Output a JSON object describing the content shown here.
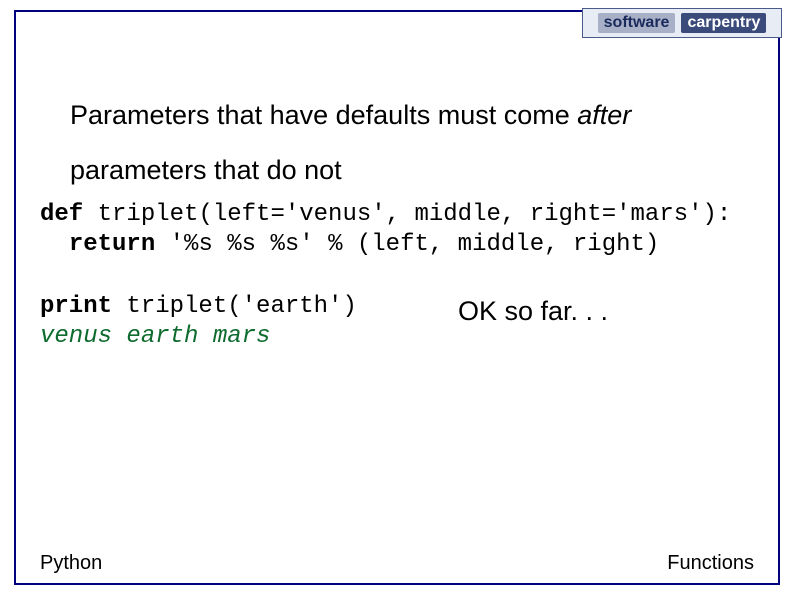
{
  "logo": {
    "word1": "software",
    "word2": "carpentry"
  },
  "heading": {
    "part1": "Parameters that have defaults must come ",
    "italic": "after",
    "part2": "parameters that do not"
  },
  "code": {
    "kw_def": "def",
    "def_rest": " triplet(left='venus', middle, right='mars'):",
    "indent": "  ",
    "kw_return": "return",
    "return_rest": " '%s %s %s' % (left, middle, right)"
  },
  "printblk": {
    "kw_print": "print",
    "print_rest": " triplet('earth')",
    "output": "venus earth mars"
  },
  "annotation": "OK so far. . .",
  "footer": {
    "left": "Python",
    "right": "Functions"
  }
}
